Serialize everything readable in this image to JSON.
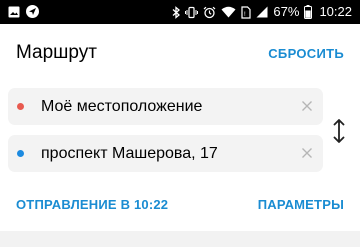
{
  "status_bar": {
    "battery_percent": "67%",
    "time": "10:22",
    "icons": [
      "image-icon",
      "navigation-icon",
      "bluetooth-icon",
      "vibrate-icon",
      "alarm-icon",
      "wifi-icon",
      "sim-icon",
      "signal-icon",
      "battery-icon"
    ]
  },
  "header": {
    "title": "Маршрут",
    "reset_label": "СБРОСИТЬ"
  },
  "route": {
    "from": "Моё местоположение",
    "to": "проспект Машерова, 17"
  },
  "footer": {
    "depart_label": "ОТПРАВЛЕНИЕ В 10:22",
    "params_label": "ПАРАМЕТРЫ"
  },
  "colors": {
    "accent": "#1a8cd2",
    "from_dot": "#e85a4f",
    "to_dot": "#1c8ae0",
    "field_bg": "#f3f3f3"
  }
}
